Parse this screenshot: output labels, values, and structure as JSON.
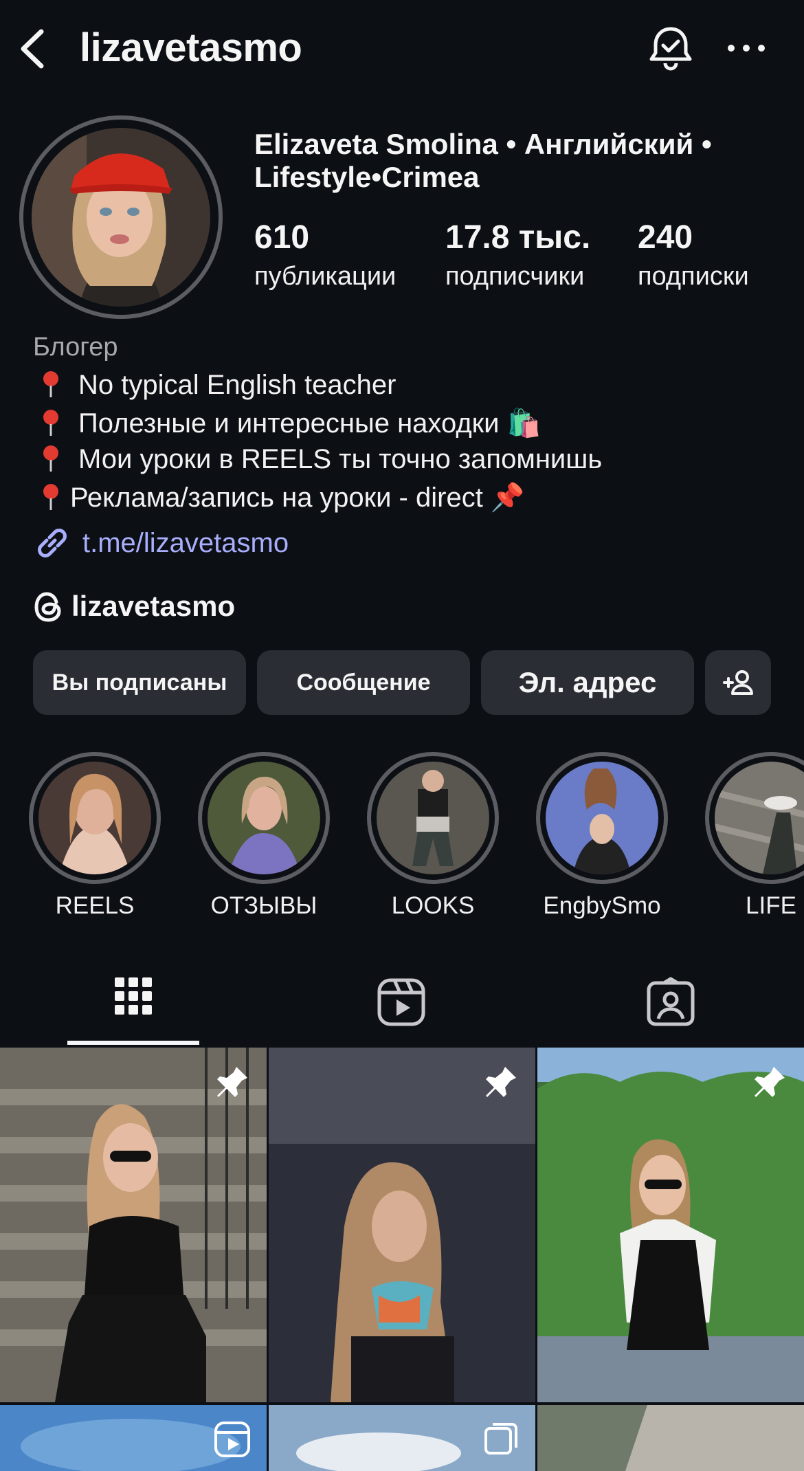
{
  "header": {
    "username": "lizavetasmo",
    "icons": [
      "back-icon",
      "notification-bell-icon",
      "more-icon"
    ]
  },
  "profile": {
    "full_name": "Elizaveta Smolina • Английский • Lifestyle•Crimea",
    "stats": [
      {
        "value": "610",
        "label": "публикации"
      },
      {
        "value": "17.8 тыс.",
        "label": "подписчики"
      },
      {
        "value": "240",
        "label": "подписки"
      }
    ],
    "category": "Блогер",
    "bio": [
      "No typical English teacher",
      "Полезные и интересные находки 🛍️",
      "Мои уроки в REELS ты точно запомнишь",
      "Реклама/запись на уроки - direct 📌"
    ],
    "link": "t.me/lizavetasmo",
    "threads_handle": "lizavetasmo"
  },
  "buttons": {
    "following": "Вы подписаны",
    "message": "Сообщение",
    "email": "Эл. адрес"
  },
  "highlights": [
    {
      "label": "REELS"
    },
    {
      "label": "ОТЗЫВЫ"
    },
    {
      "label": "LOOKS"
    },
    {
      "label": "EngbySmo"
    },
    {
      "label": "LIFE"
    }
  ],
  "tabs": [
    "grid-icon",
    "reels-icon",
    "tagged-icon"
  ],
  "colors": {
    "background": "#0c0f14",
    "button": "#2a2d33",
    "link": "#a8aefb",
    "ring": "#5b5d63"
  }
}
